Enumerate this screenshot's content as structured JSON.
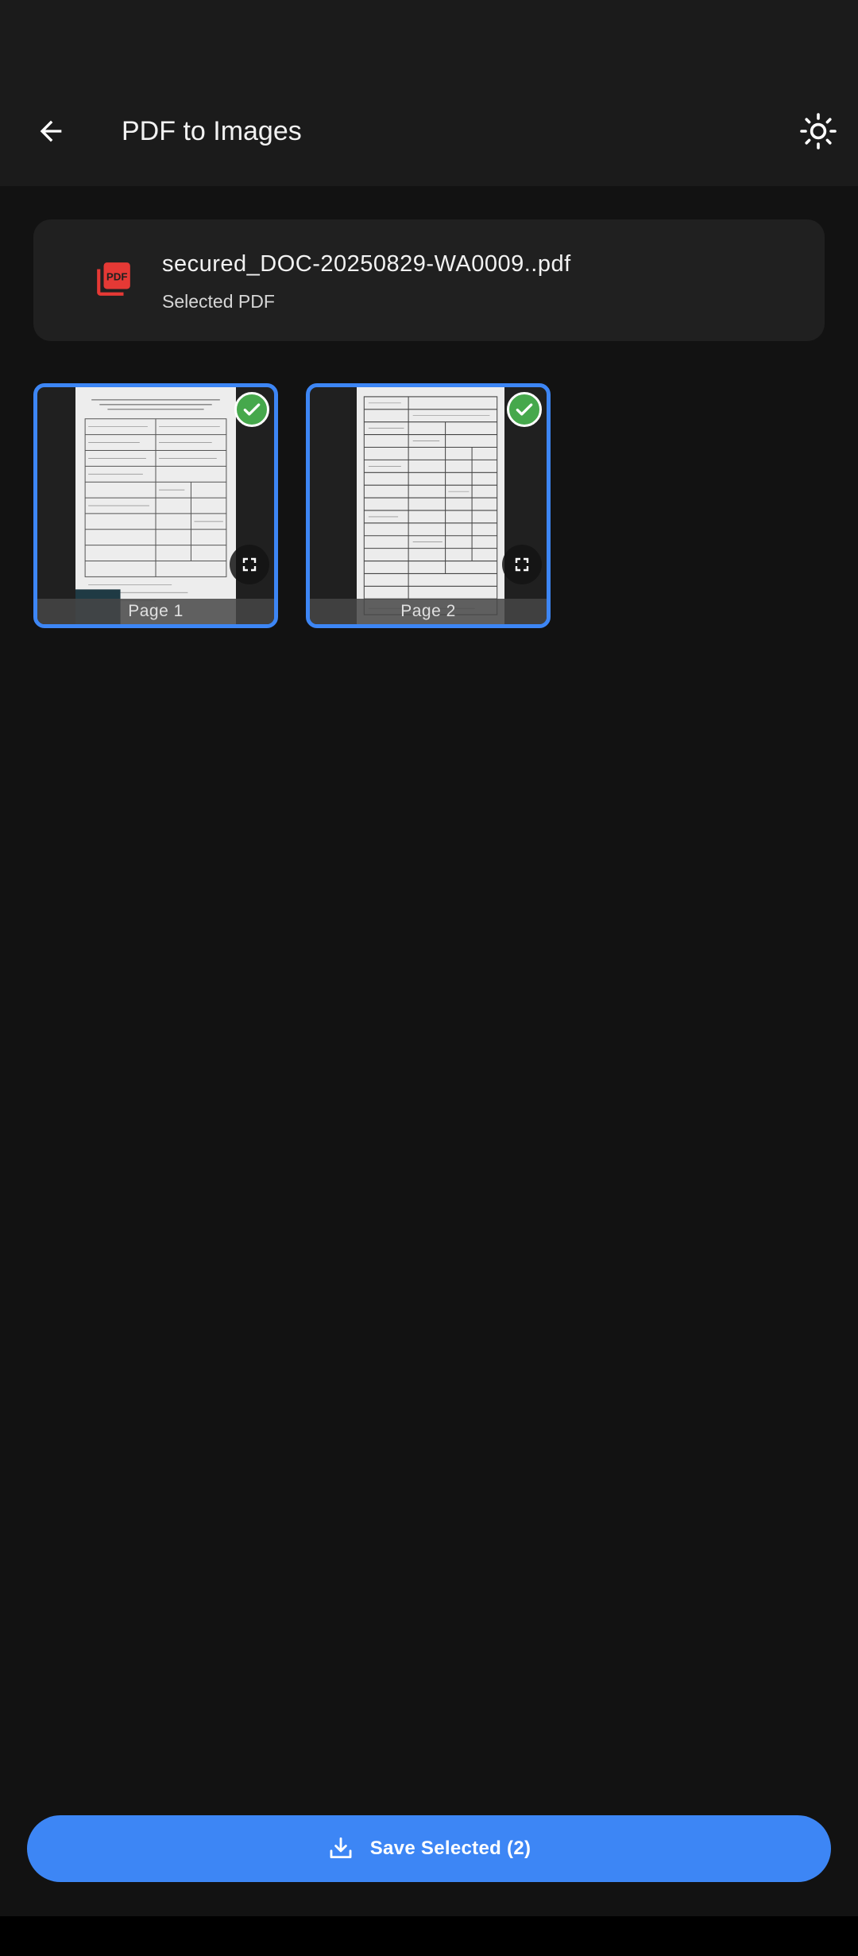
{
  "app_bar": {
    "title": "PDF to Images",
    "back_icon": "arrow-left-icon",
    "theme_icon": "sun-icon"
  },
  "file": {
    "name": "secured_DOC-20250829-WA0009..pdf",
    "subtitle": "Selected PDF",
    "icon": "pdf-file-icon",
    "icon_color": "#e53935"
  },
  "pages": [
    {
      "label": "Page 1",
      "selected": true
    },
    {
      "label": "Page 2",
      "selected": true
    }
  ],
  "actions": {
    "save_label": "Save Selected (2)",
    "save_icon": "download-icon"
  },
  "colors": {
    "accent": "#3d86f5",
    "check": "#46a84c",
    "background": "#121212",
    "card": "#202020"
  }
}
